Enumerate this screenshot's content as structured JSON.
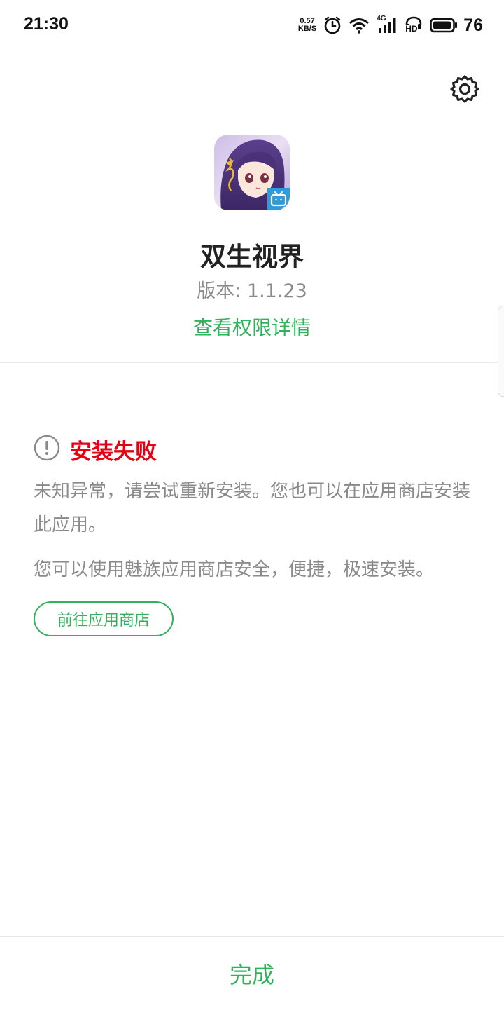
{
  "status_bar": {
    "time": "21:30",
    "net_speed_value": "0.57",
    "net_speed_unit": "KB/S",
    "network_type": "4G",
    "hd_label": "HD",
    "battery_level": "76",
    "icons": [
      "alarm-icon",
      "wifi-icon",
      "signal-icon",
      "hd-icon",
      "battery-icon"
    ]
  },
  "header": {
    "settings_icon": "gear-icon"
  },
  "app": {
    "name": "双生视界",
    "version": "版本: 1.1.23",
    "permission_link": "查看权限详情",
    "icon_badge": "bilibili-tv-icon"
  },
  "result": {
    "status_icon": "exclamation-circle-icon",
    "title": "安装失败",
    "message": "未知异常，请尝试重新安装。您也可以在应用商店安装此应用。",
    "store_tip": "您可以使用魅族应用商店安全，便捷，极速安装。",
    "store_button": "前往应用商店"
  },
  "footer": {
    "done_button": "完成"
  },
  "colors": {
    "accent_green": "#2fb35a",
    "error_red": "#e60012",
    "secondary_text": "#8a8a8a"
  }
}
